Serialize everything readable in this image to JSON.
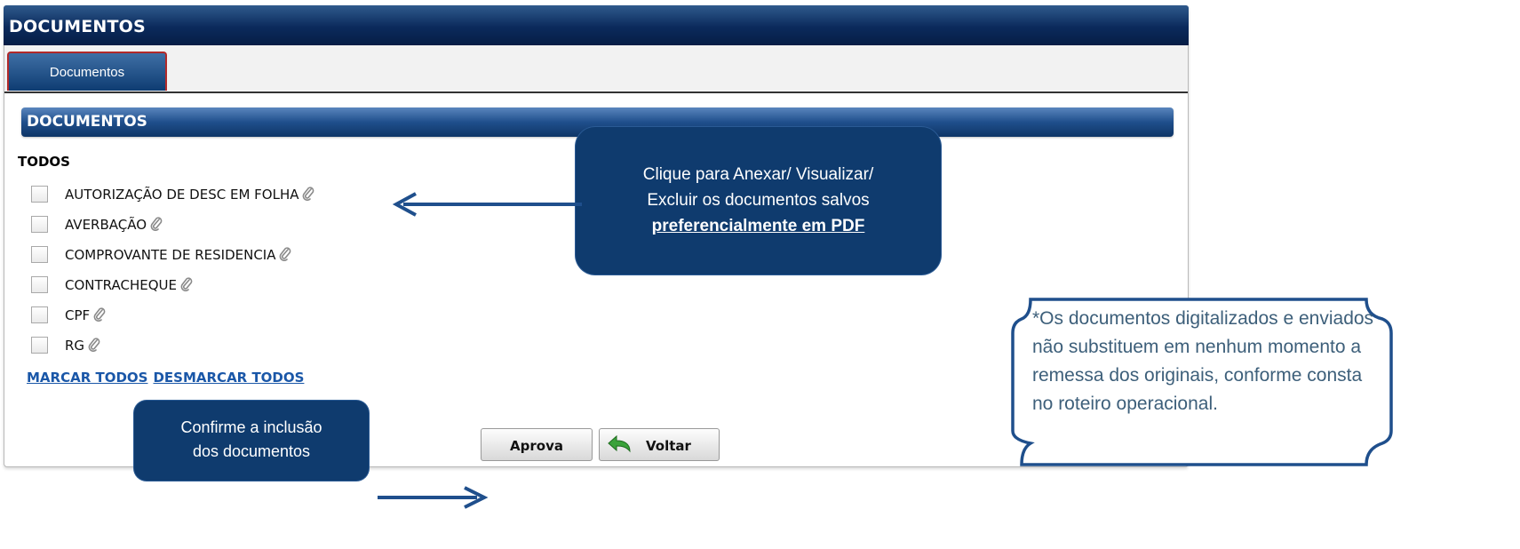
{
  "window": {
    "title": "DOCUMENTOS"
  },
  "tabs": [
    {
      "label": "Documentos",
      "active": true
    }
  ],
  "section": {
    "title": "DOCUMENTOS",
    "group_label": "TODOS"
  },
  "documents": [
    {
      "label": "AUTORIZAÇÃO DE DESC EM FOLHA",
      "checked": false,
      "icon": "paperclip-icon"
    },
    {
      "label": "AVERBAÇÃO",
      "checked": false,
      "icon": "paperclip-icon"
    },
    {
      "label": "COMPROVANTE DE RESIDENCIA",
      "checked": false,
      "icon": "paperclip-icon"
    },
    {
      "label": "CONTRACHEQUE",
      "checked": false,
      "icon": "paperclip-icon"
    },
    {
      "label": "CPF",
      "checked": false,
      "icon": "paperclip-icon"
    },
    {
      "label": "RG",
      "checked": false,
      "icon": "paperclip-icon"
    }
  ],
  "links": {
    "mark_all": "MARCAR TODOS",
    "unmark_all": "DESMARCAR TODOS"
  },
  "buttons": {
    "approve": "Aprova",
    "back": "Voltar",
    "back_icon": "return-arrow-icon"
  },
  "callouts": {
    "attach": {
      "line1": "Clique para Anexar/ Visualizar/",
      "line2": "Excluir  os documentos salvos",
      "line3": "preferencialmente em PDF"
    },
    "confirm": {
      "line1": "Confirme a inclusão",
      "line2": "dos documentos"
    }
  },
  "note": {
    "text": "*Os documentos digitalizados e enviados não substituem em nenhum momento a remessa dos originais, conforme consta no roteiro operacional."
  },
  "colors": {
    "header_navy": "#0b2a5c",
    "section_blue": "#1f4f8c",
    "callout_fill": "#0f3b6e",
    "link_blue": "#1a57a8",
    "note_text": "#3d5f7a",
    "tab_border_red": "#b22a2a"
  }
}
